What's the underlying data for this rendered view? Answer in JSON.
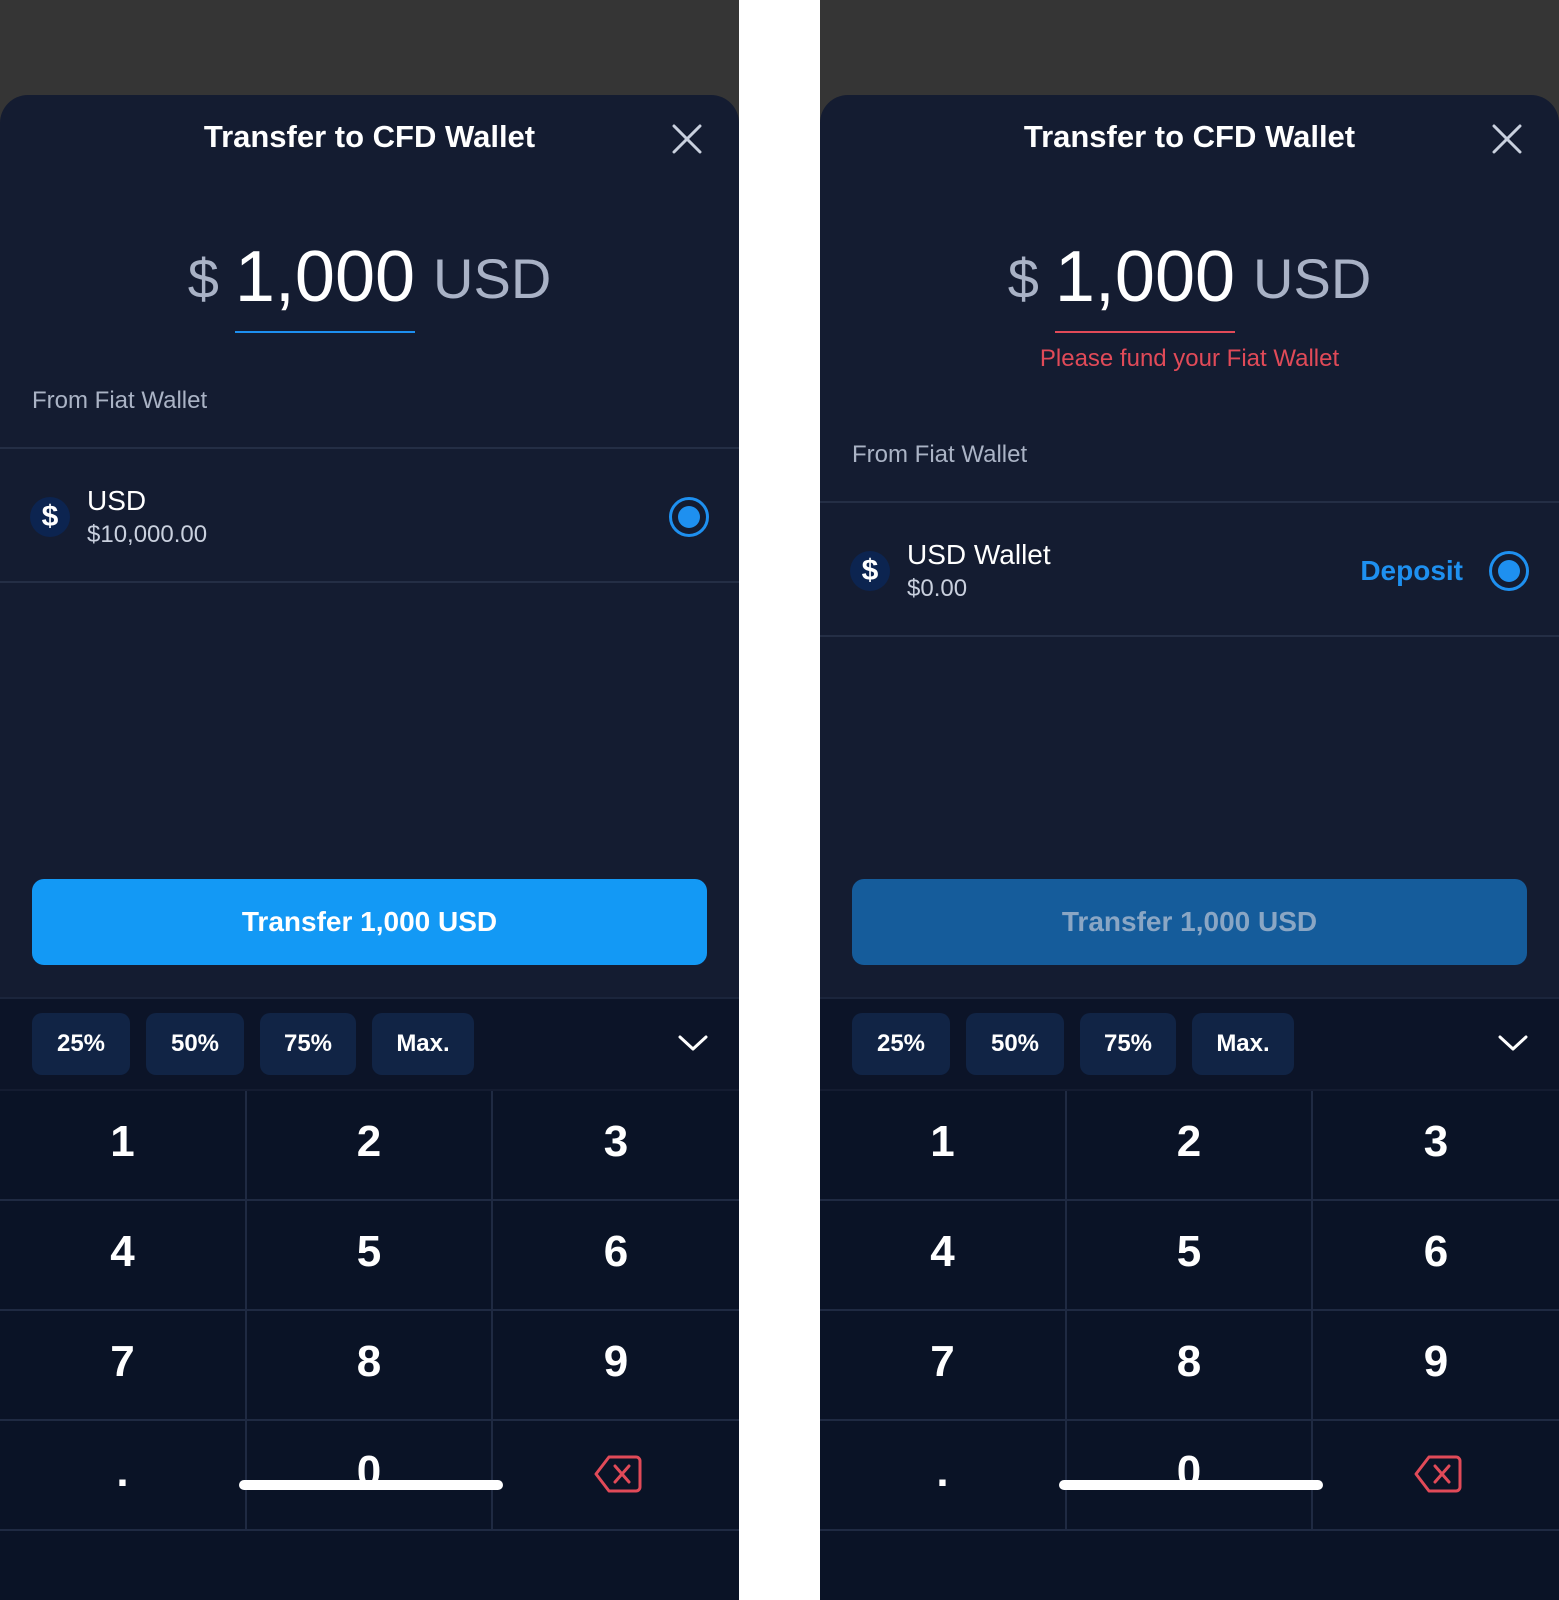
{
  "left": {
    "title": "Transfer to CFD Wallet",
    "currency_symbol": "$",
    "amount": "1,000",
    "unit": "USD",
    "section_label": "From Fiat Wallet",
    "wallet": {
      "icon": "dollar-icon",
      "symbol": "$",
      "name": "USD",
      "balance": "$10,000.00",
      "selected": true
    },
    "cta_label": "Transfer 1,000 USD",
    "quick_amounts": [
      "25%",
      "50%",
      "75%",
      "Max."
    ],
    "keys": [
      "1",
      "2",
      "3",
      "4",
      "5",
      "6",
      "7",
      "8",
      "9",
      ".",
      "0"
    ]
  },
  "right": {
    "title": "Transfer to CFD Wallet",
    "currency_symbol": "$",
    "amount": "1,000",
    "unit": "USD",
    "error": "Please fund your Fiat Wallet",
    "section_label": "From Fiat Wallet",
    "wallet": {
      "icon": "dollar-icon",
      "symbol": "$",
      "name": "USD Wallet",
      "balance": "$0.00",
      "action": "Deposit",
      "selected": true
    },
    "cta_label": "Transfer 1,000 USD",
    "cta_disabled": true,
    "quick_amounts": [
      "25%",
      "50%",
      "75%",
      "Max."
    ],
    "keys": [
      "1",
      "2",
      "3",
      "4",
      "5",
      "6",
      "7",
      "8",
      "9",
      ".",
      "0"
    ]
  },
  "colors": {
    "accent": "#1399f5",
    "error": "#e14a58",
    "sheet": "#141c31",
    "keypad": "#0a1326"
  }
}
